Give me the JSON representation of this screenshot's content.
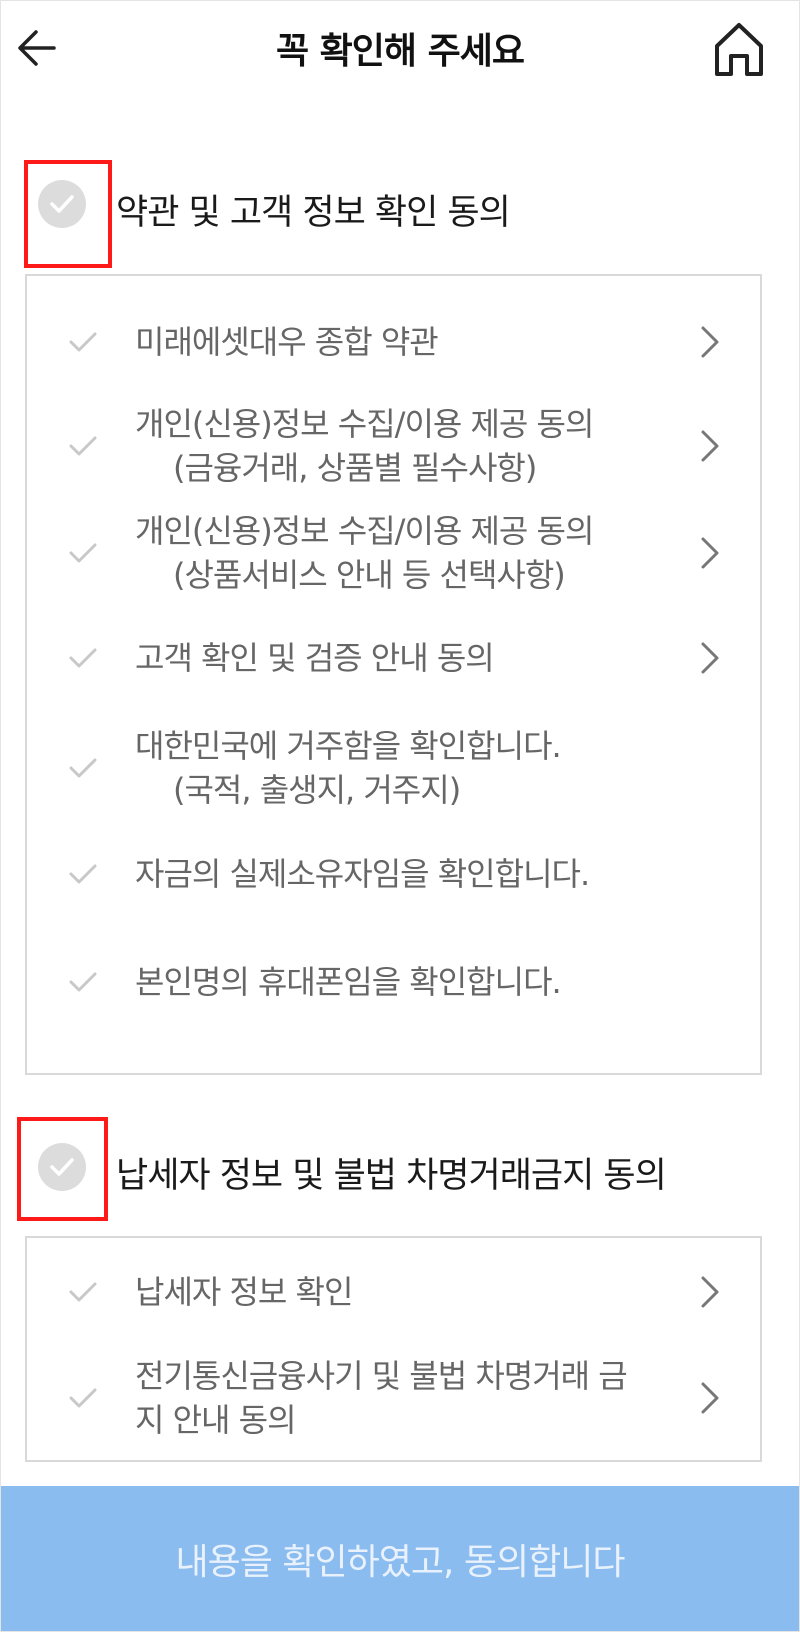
{
  "header": {
    "title": "꼭 확인해 주세요",
    "back_icon": "arrow-left-icon",
    "home_icon": "home-icon"
  },
  "sections": [
    {
      "title": "약관 및 고객 정보 확인 동의",
      "items": [
        {
          "line1": "미래에셋대우 종합 약관",
          "line2": "",
          "has_arrow": true
        },
        {
          "line1": "개인(신용)정보 수집/이용 제공 동의",
          "line2": "(금융거래, 상품별 필수사항)",
          "has_arrow": true
        },
        {
          "line1": "개인(신용)정보 수집/이용 제공 동의",
          "line2": "(상품서비스 안내 등 선택사항)",
          "has_arrow": true
        },
        {
          "line1": "고객 확인 및 검증 안내 동의",
          "line2": "",
          "has_arrow": true
        },
        {
          "line1": "대한민국에 거주함을 확인합니다.",
          "line2": "(국적, 출생지, 거주지)",
          "has_arrow": false
        },
        {
          "line1": "자금의 실제소유자임을 확인합니다.",
          "line2": "",
          "has_arrow": false
        },
        {
          "line1": "본인명의 휴대폰임을 확인합니다.",
          "line2": "",
          "has_arrow": false
        }
      ]
    },
    {
      "title": "납세자 정보 및 불법 차명거래금지 동의",
      "items": [
        {
          "line1": "납세자 정보 확인",
          "line2": "",
          "has_arrow": true
        },
        {
          "line1": "전기통신금융사기 및 불법 차명거래 금",
          "line2": "지 안내 동의",
          "has_arrow": true
        }
      ]
    }
  ],
  "confirm_button": {
    "label": "내용을 확인하였고, 동의합니다"
  },
  "colors": {
    "highlight": "#ff1a1a",
    "confirm_bg": "#8bbcef",
    "confirm_text": "#e9f2fc",
    "check_grey": "#dcdcdc",
    "item_text": "#666666",
    "box_border": "#d9d9d9"
  }
}
